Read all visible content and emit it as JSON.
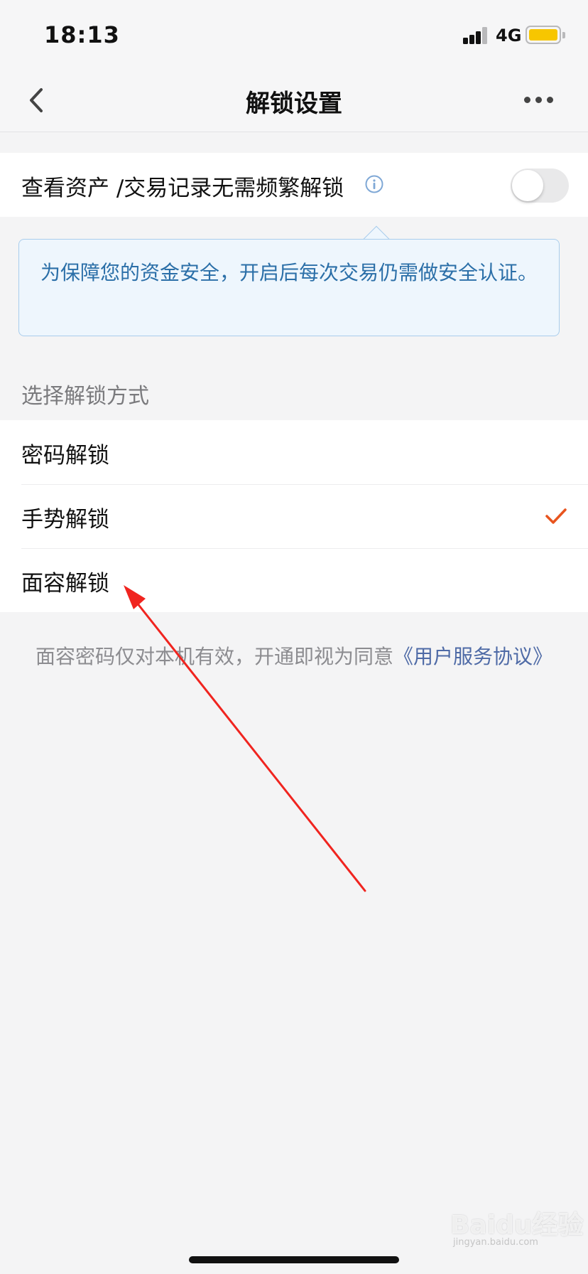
{
  "status_bar": {
    "time": "18:13",
    "network": "4G",
    "battery_color": "#f7c600"
  },
  "nav": {
    "title": "解锁设置",
    "back_icon": "chevron-left-icon",
    "more_icon": "more-horizontal-icon"
  },
  "asset_toggle": {
    "label": "查看资产 /交易记录无需频繁解锁",
    "info_icon": "info-icon",
    "enabled": false
  },
  "tooltip": {
    "text": "为保障您的资金安全，开启后每次交易仍需做安全认证。"
  },
  "unlock_methods": {
    "header": "选择解锁方式",
    "items": [
      {
        "label": "密码解锁",
        "selected": false
      },
      {
        "label": "手势解锁",
        "selected": true
      },
      {
        "label": "面容解锁",
        "selected": false
      }
    ],
    "check_color": "#e8541e"
  },
  "footer": {
    "text": "面容密码仅对本机有效，开通即视为同意",
    "link": "《用户服务协议》"
  },
  "annotation": {
    "arrow_color": "#f0241f"
  },
  "watermark": {
    "brand": "Baidu经验",
    "url": "jingyan.baidu.com"
  }
}
